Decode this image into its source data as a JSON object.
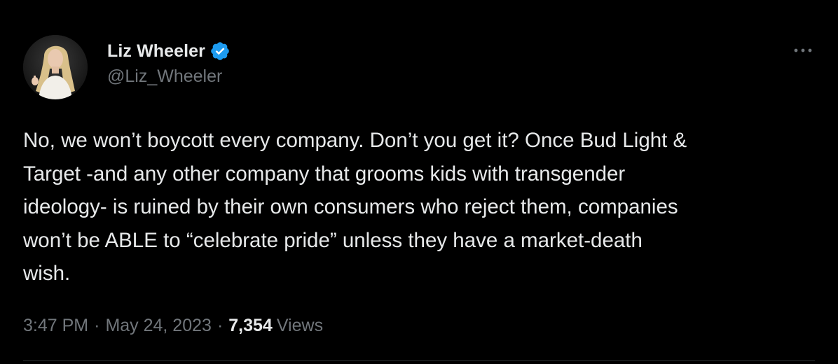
{
  "author": {
    "display_name": "Liz Wheeler",
    "handle": "@Liz_Wheeler",
    "verified": true,
    "avatar_icon": "profile-photo"
  },
  "tweet": {
    "text": "No, we won’t boycott every company. Don’t you get it? Once Bud Light &\nTarget -and any other company that grooms kids with transgender\nideology- is ruined by their own consumers who reject them, companies\nwon’t be ABLE to “celebrate pride” unless they have a market-death\nwish."
  },
  "meta": {
    "time": "3:47 PM",
    "separator": "·",
    "date": "May 24, 2023",
    "views_count": "7,354",
    "views_label": "Views"
  },
  "icons": {
    "verified": "verified-badge-icon",
    "more": "more-options-icon"
  },
  "colors": {
    "background": "#000000",
    "text_primary": "#e7e9ea",
    "text_secondary": "#71767b",
    "verified_blue": "#1d9bf0",
    "divider": "#2f3336"
  }
}
